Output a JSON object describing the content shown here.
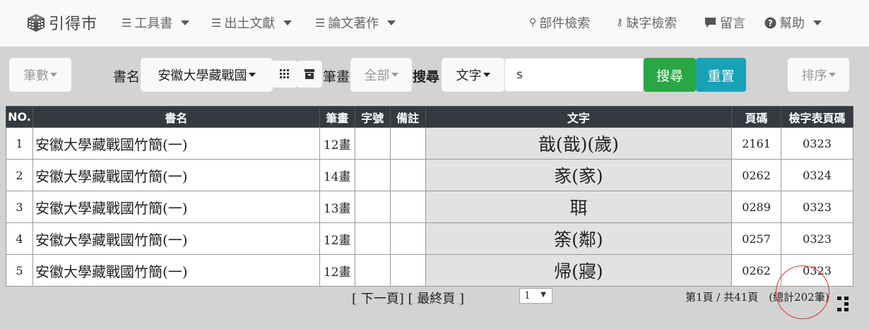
{
  "brand": {
    "name": "引得市"
  },
  "nav": {
    "left": [
      {
        "label": "工具書"
      },
      {
        "label": "出土文獻"
      },
      {
        "label": "論文著作"
      }
    ],
    "right": {
      "component_search": "部件檢索",
      "missing_char_search": "缺字檢索",
      "message": "留言",
      "help": "幫助"
    }
  },
  "toolbar": {
    "stroke_count_button": "筆數",
    "book_label": "書名",
    "book_select": "安徽大學藏戰國",
    "strokes_label": "筆畫",
    "strokes_select": "全部",
    "search_label": "搜尋",
    "search_type_select": "文字",
    "search_value": "s",
    "search_button": "搜尋",
    "reset_button": "重置",
    "sort_button": "排序"
  },
  "table": {
    "headers": [
      "NO.",
      "書名",
      "筆畫",
      "字號",
      "備註",
      "文字",
      "頁碼",
      "檢字表頁碼"
    ],
    "rows": [
      {
        "no": "1",
        "book": "安徽大學藏戰國竹簡(一)",
        "strokes": "12畫",
        "char_no": "",
        "note": "",
        "text": "戠(戠)(歲)",
        "page": "2161",
        "index_page": "0323"
      },
      {
        "no": "2",
        "book": "安徽大學藏戰國竹簡(一)",
        "strokes": "14畫",
        "char_no": "",
        "note": "",
        "text": "豙(豙)",
        "page": "0262",
        "index_page": "0324"
      },
      {
        "no": "3",
        "book": "安徽大學藏戰國竹簡(一)",
        "strokes": "13畫",
        "char_no": "",
        "note": "",
        "text": "聑",
        "page": "0289",
        "index_page": "0323"
      },
      {
        "no": "4",
        "book": "安徽大學藏戰國竹簡(一)",
        "strokes": "12畫",
        "char_no": "",
        "note": "",
        "text": "筡(鄰)",
        "page": "0257",
        "index_page": "0323"
      },
      {
        "no": "5",
        "book": "安徽大學藏戰國竹簡(一)",
        "strokes": "12畫",
        "char_no": "",
        "note": "",
        "text": "帰(寢)",
        "page": "0262",
        "index_page": "0323"
      }
    ]
  },
  "pagination": {
    "next": "[ 下一頁]",
    "last": "[ 最終頁 ]",
    "current_page": "1",
    "info": "第1頁 / 共41頁　(總計202筆)"
  }
}
